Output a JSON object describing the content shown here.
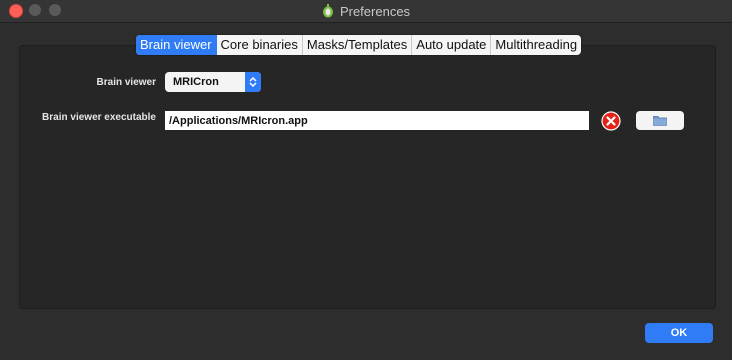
{
  "window": {
    "title": "Preferences"
  },
  "tabs": [
    {
      "label": "Brain viewer",
      "active": true
    },
    {
      "label": "Core binaries",
      "active": false
    },
    {
      "label": "Masks/Templates",
      "active": false
    },
    {
      "label": "Auto update",
      "active": false
    },
    {
      "label": "Multithreading",
      "active": false
    }
  ],
  "brain_viewer": {
    "label": "Brain viewer",
    "selected": "MRICron"
  },
  "executable": {
    "label": "Brain viewer executable",
    "value": "/Applications/MRIcron.app"
  },
  "footer": {
    "ok_label": "OK"
  },
  "colors": {
    "accent": "#2f7cf6",
    "close": "#fe5f57"
  },
  "icons": {
    "clear": "clear-icon",
    "browse": "folder-icon",
    "stepper": "up-down-chevron-icon"
  }
}
